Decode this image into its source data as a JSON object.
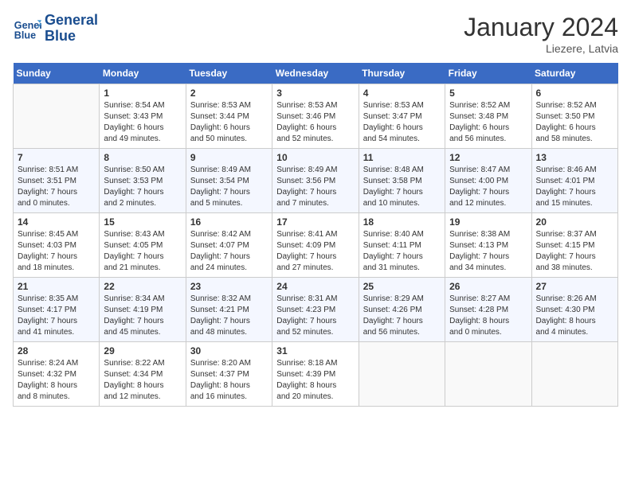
{
  "header": {
    "logo_line1": "General",
    "logo_line2": "Blue",
    "month_title": "January 2024",
    "location": "Liezere, Latvia"
  },
  "days_of_week": [
    "Sunday",
    "Monday",
    "Tuesday",
    "Wednesday",
    "Thursday",
    "Friday",
    "Saturday"
  ],
  "weeks": [
    [
      {
        "day": "",
        "info": ""
      },
      {
        "day": "1",
        "info": "Sunrise: 8:54 AM\nSunset: 3:43 PM\nDaylight: 6 hours\nand 49 minutes."
      },
      {
        "day": "2",
        "info": "Sunrise: 8:53 AM\nSunset: 3:44 PM\nDaylight: 6 hours\nand 50 minutes."
      },
      {
        "day": "3",
        "info": "Sunrise: 8:53 AM\nSunset: 3:46 PM\nDaylight: 6 hours\nand 52 minutes."
      },
      {
        "day": "4",
        "info": "Sunrise: 8:53 AM\nSunset: 3:47 PM\nDaylight: 6 hours\nand 54 minutes."
      },
      {
        "day": "5",
        "info": "Sunrise: 8:52 AM\nSunset: 3:48 PM\nDaylight: 6 hours\nand 56 minutes."
      },
      {
        "day": "6",
        "info": "Sunrise: 8:52 AM\nSunset: 3:50 PM\nDaylight: 6 hours\nand 58 minutes."
      }
    ],
    [
      {
        "day": "7",
        "info": "Sunrise: 8:51 AM\nSunset: 3:51 PM\nDaylight: 7 hours\nand 0 minutes."
      },
      {
        "day": "8",
        "info": "Sunrise: 8:50 AM\nSunset: 3:53 PM\nDaylight: 7 hours\nand 2 minutes."
      },
      {
        "day": "9",
        "info": "Sunrise: 8:49 AM\nSunset: 3:54 PM\nDaylight: 7 hours\nand 5 minutes."
      },
      {
        "day": "10",
        "info": "Sunrise: 8:49 AM\nSunset: 3:56 PM\nDaylight: 7 hours\nand 7 minutes."
      },
      {
        "day": "11",
        "info": "Sunrise: 8:48 AM\nSunset: 3:58 PM\nDaylight: 7 hours\nand 10 minutes."
      },
      {
        "day": "12",
        "info": "Sunrise: 8:47 AM\nSunset: 4:00 PM\nDaylight: 7 hours\nand 12 minutes."
      },
      {
        "day": "13",
        "info": "Sunrise: 8:46 AM\nSunset: 4:01 PM\nDaylight: 7 hours\nand 15 minutes."
      }
    ],
    [
      {
        "day": "14",
        "info": "Sunrise: 8:45 AM\nSunset: 4:03 PM\nDaylight: 7 hours\nand 18 minutes."
      },
      {
        "day": "15",
        "info": "Sunrise: 8:43 AM\nSunset: 4:05 PM\nDaylight: 7 hours\nand 21 minutes."
      },
      {
        "day": "16",
        "info": "Sunrise: 8:42 AM\nSunset: 4:07 PM\nDaylight: 7 hours\nand 24 minutes."
      },
      {
        "day": "17",
        "info": "Sunrise: 8:41 AM\nSunset: 4:09 PM\nDaylight: 7 hours\nand 27 minutes."
      },
      {
        "day": "18",
        "info": "Sunrise: 8:40 AM\nSunset: 4:11 PM\nDaylight: 7 hours\nand 31 minutes."
      },
      {
        "day": "19",
        "info": "Sunrise: 8:38 AM\nSunset: 4:13 PM\nDaylight: 7 hours\nand 34 minutes."
      },
      {
        "day": "20",
        "info": "Sunrise: 8:37 AM\nSunset: 4:15 PM\nDaylight: 7 hours\nand 38 minutes."
      }
    ],
    [
      {
        "day": "21",
        "info": "Sunrise: 8:35 AM\nSunset: 4:17 PM\nDaylight: 7 hours\nand 41 minutes."
      },
      {
        "day": "22",
        "info": "Sunrise: 8:34 AM\nSunset: 4:19 PM\nDaylight: 7 hours\nand 45 minutes."
      },
      {
        "day": "23",
        "info": "Sunrise: 8:32 AM\nSunset: 4:21 PM\nDaylight: 7 hours\nand 48 minutes."
      },
      {
        "day": "24",
        "info": "Sunrise: 8:31 AM\nSunset: 4:23 PM\nDaylight: 7 hours\nand 52 minutes."
      },
      {
        "day": "25",
        "info": "Sunrise: 8:29 AM\nSunset: 4:26 PM\nDaylight: 7 hours\nand 56 minutes."
      },
      {
        "day": "26",
        "info": "Sunrise: 8:27 AM\nSunset: 4:28 PM\nDaylight: 8 hours\nand 0 minutes."
      },
      {
        "day": "27",
        "info": "Sunrise: 8:26 AM\nSunset: 4:30 PM\nDaylight: 8 hours\nand 4 minutes."
      }
    ],
    [
      {
        "day": "28",
        "info": "Sunrise: 8:24 AM\nSunset: 4:32 PM\nDaylight: 8 hours\nand 8 minutes."
      },
      {
        "day": "29",
        "info": "Sunrise: 8:22 AM\nSunset: 4:34 PM\nDaylight: 8 hours\nand 12 minutes."
      },
      {
        "day": "30",
        "info": "Sunrise: 8:20 AM\nSunset: 4:37 PM\nDaylight: 8 hours\nand 16 minutes."
      },
      {
        "day": "31",
        "info": "Sunrise: 8:18 AM\nSunset: 4:39 PM\nDaylight: 8 hours\nand 20 minutes."
      },
      {
        "day": "",
        "info": ""
      },
      {
        "day": "",
        "info": ""
      },
      {
        "day": "",
        "info": ""
      }
    ]
  ]
}
